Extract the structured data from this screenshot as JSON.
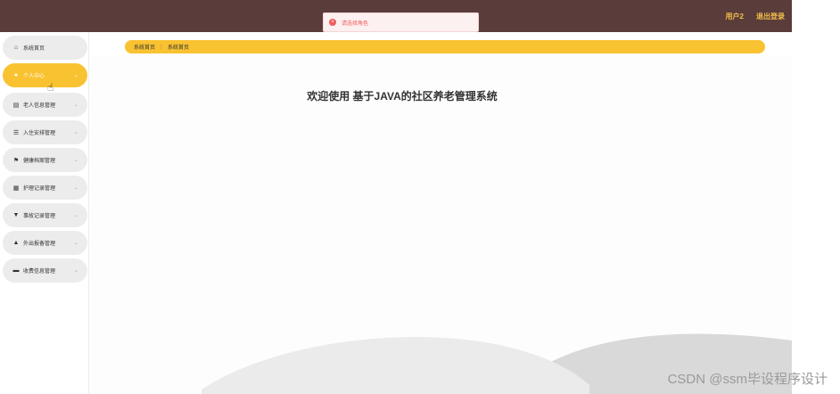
{
  "header": {
    "user_label": "用户2",
    "logout_label": "退出登录"
  },
  "toast": {
    "icon": "error-icon",
    "message": "请选择角色"
  },
  "sidebar": {
    "items": [
      {
        "label": "系统首页",
        "icon": "home-icon",
        "active": false
      },
      {
        "label": "个人中心",
        "icon": "user-icon",
        "active": true
      },
      {
        "label": "老人信息管理",
        "icon": "document-icon",
        "active": false
      },
      {
        "label": "入住安排管理",
        "icon": "list-icon",
        "active": false
      },
      {
        "label": "健康档案管理",
        "icon": "flag-icon",
        "active": false
      },
      {
        "label": "护理记录管理",
        "icon": "grid-icon",
        "active": false
      },
      {
        "label": "事故记录管理",
        "icon": "pin-icon",
        "active": false
      },
      {
        "label": "外出报备管理",
        "icon": "car-icon",
        "active": false
      },
      {
        "label": "收费信息管理",
        "icon": "monitor-icon",
        "active": false
      }
    ]
  },
  "breadcrumb": {
    "items": [
      "系统首页",
      "系统首页"
    ],
    "separator": "⋮"
  },
  "main": {
    "welcome": "欢迎使用 基于JAVA的社区养老管理系统"
  },
  "watermark": "CSDN @ssm毕设程序设计",
  "colors": {
    "topbar": "#5a3c3a",
    "accent": "#f9c231",
    "error": "#f25b5b"
  }
}
